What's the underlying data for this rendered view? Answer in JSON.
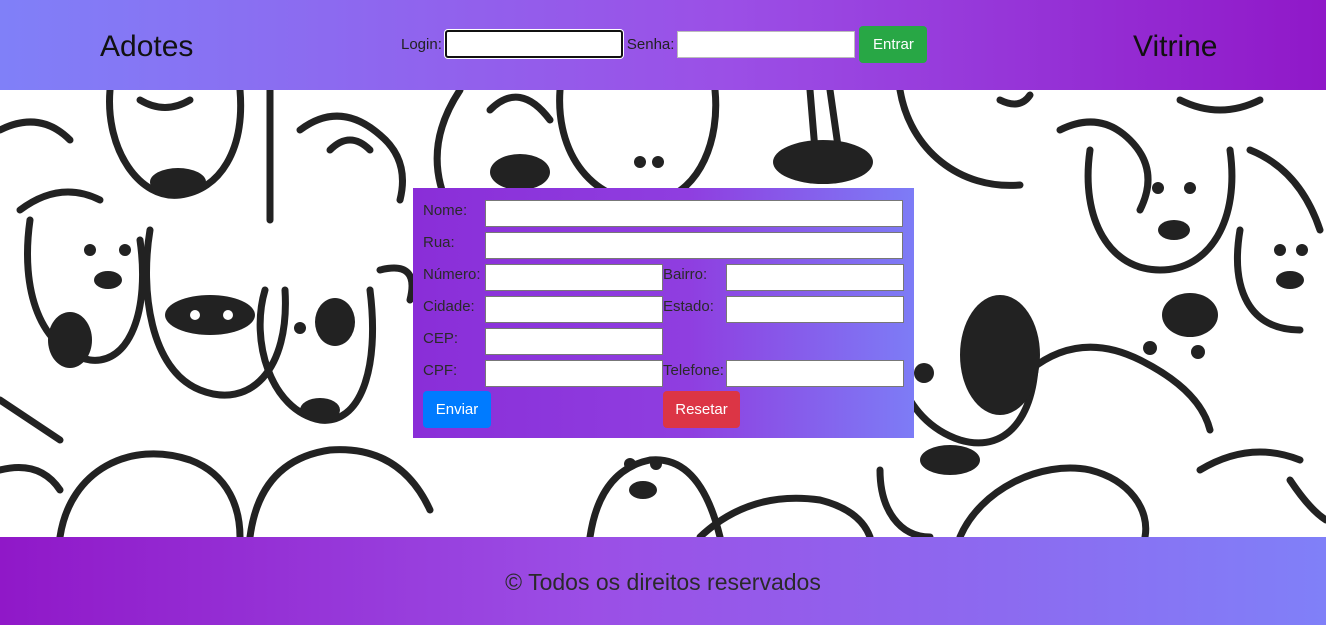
{
  "header": {
    "brand_left": "Adotes",
    "brand_right": "Vitrine",
    "login_label": "Login:",
    "login_value": "",
    "password_label": "Senha:",
    "password_value": "",
    "enter_button": "Entrar"
  },
  "form": {
    "nome_label": "Nome:",
    "rua_label": "Rua:",
    "numero_label": "Número:",
    "bairro_label": "Bairro:",
    "cidade_label": "Cidade:",
    "estado_label": "Estado:",
    "cep_label": "CEP:",
    "cpf_label": "CPF:",
    "telefone_label": "Telefone:",
    "submit_button": "Enviar",
    "reset_button": "Resetar"
  },
  "footer": {
    "copyright": "© Todos os direitos reservados"
  },
  "colors": {
    "header_gradient": [
      "#8080f8",
      "#9018c8"
    ],
    "footer_gradient": [
      "#9018c8",
      "#8080f8"
    ],
    "form_gradient": [
      "#8a2ed8",
      "#7d7cf6"
    ],
    "enter_button": "#28a745",
    "submit_button": "#007bff",
    "reset_button": "#dc3545"
  },
  "background_image": "dog-doodle-pattern"
}
